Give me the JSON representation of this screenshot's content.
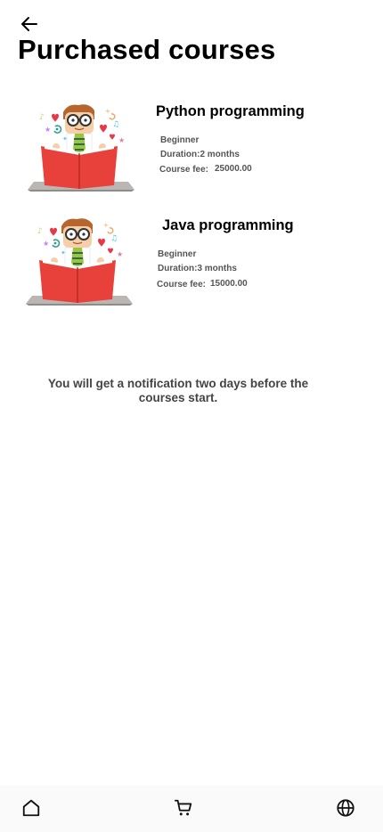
{
  "header": {
    "back_icon": "arrow-left-icon",
    "title": "Purchased courses"
  },
  "courses": [
    {
      "name": "Python programming",
      "level": "Beginner",
      "duration": "Duration:2 months",
      "fee_label": "Course fee:",
      "fee_value": "25000.00",
      "image": "boy-reading-book-illustration"
    },
    {
      "name": "Java programming",
      "level": "Beginner",
      "duration": "Duration:3 months",
      "fee_label": "Course fee:",
      "fee_value": "15000.00",
      "image": "boy-reading-book-illustration"
    }
  ],
  "notice": "You will get a notification two days before the courses start.",
  "bottom_nav": {
    "items": [
      {
        "icon": "home-icon"
      },
      {
        "icon": "cart-icon"
      },
      {
        "icon": "globe-icon"
      }
    ]
  },
  "colors": {
    "book_red": "#e8403a",
    "tie_green": "#9bc53d",
    "hair_brown": "#b5652d",
    "heart_red": "#e63946",
    "nav_background": "#fafafa"
  }
}
